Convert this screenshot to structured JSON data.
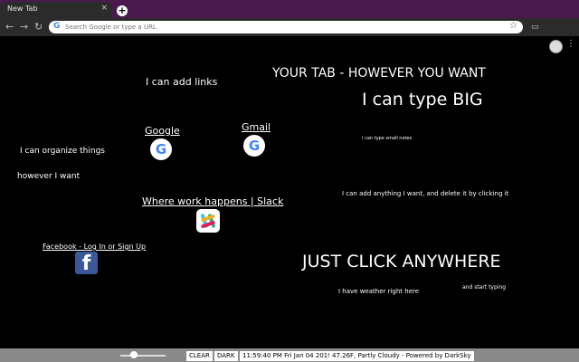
{
  "browser": {
    "tab_title": "New Tab",
    "tab_close": "×",
    "new_tab": "+",
    "omnibox_placeholder": "Search Google or type a URL",
    "omnibox_logo": "G"
  },
  "page": {
    "headline": "YOUR TAB - HOWEVER YOU WANT",
    "type_big": "I can type BIG",
    "add_links": "I can add links",
    "small_notes": "I can type small notes",
    "organize": "I can organize things",
    "however": "however I want",
    "add_anything": "I can add anything I want, and delete it by clicking it",
    "click_anywhere": "JUST CLICK ANYWHERE",
    "weather_here": "I have weather right here",
    "start_typing": "and start typing"
  },
  "links": [
    {
      "label": "Google",
      "icon": "google-icon",
      "glyph": "G"
    },
    {
      "label": "Gmail",
      "icon": "google-icon",
      "glyph": "G"
    },
    {
      "label": "Where work happens | Slack",
      "icon": "slack-icon"
    },
    {
      "label": "Facebook - Log In or Sign Up",
      "icon": "facebook-icon",
      "glyph": "f"
    }
  ],
  "bottom_bar": {
    "clear": "CLEAR",
    "dark": "DARK",
    "datetime": "11:59:40 PM Fri Jan 04 2019",
    "weather": "47.26F, Partly Cloudy - Powered by DarkSky"
  },
  "brightness_level": 0.3,
  "colors": {
    "tabstrip": "#4a1a4e",
    "background": "#000000",
    "bottom_bar": "#8a8a8a",
    "facebook": "#3b5998"
  }
}
